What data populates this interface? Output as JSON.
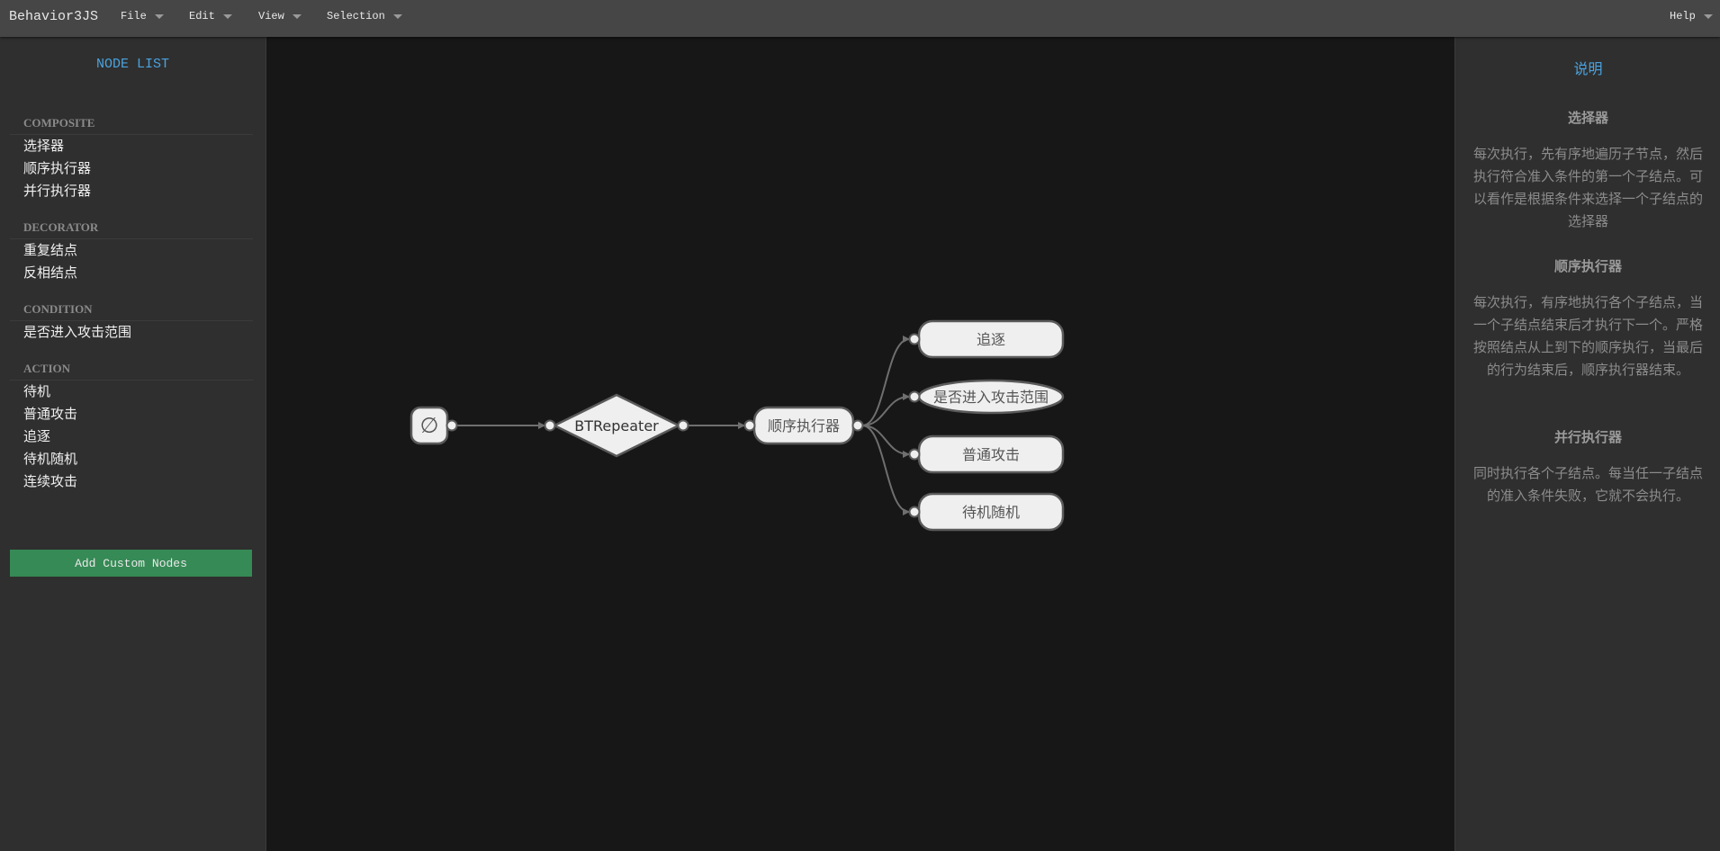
{
  "app": {
    "title": "Behavior3JS"
  },
  "menus": [
    {
      "label": "File"
    },
    {
      "label": "Edit"
    },
    {
      "label": "View"
    },
    {
      "label": "Selection"
    }
  ],
  "help_menu": {
    "label": "Help"
  },
  "sidebar": {
    "title": "NODE LIST",
    "sections": [
      {
        "name": "COMPOSITE",
        "items": [
          "选择器",
          "顺序执行器",
          "并行执行器"
        ]
      },
      {
        "name": "DECORATOR",
        "items": [
          "重复结点",
          "反相结点"
        ]
      },
      {
        "name": "CONDITION",
        "items": [
          "是否进入攻击范围"
        ]
      },
      {
        "name": "ACTION",
        "items": [
          "待机",
          "普通攻击",
          "追逐",
          "待机随机",
          "连续攻击"
        ]
      }
    ],
    "add_button": "Add Custom Nodes",
    "add_button_color": "#368a55"
  },
  "graph": {
    "nodes": [
      {
        "id": "root",
        "type": "root",
        "label": "∅"
      },
      {
        "id": "repeater",
        "type": "decorator",
        "label": "BTRepeater"
      },
      {
        "id": "sequence",
        "type": "composite",
        "label": "顺序执行器"
      },
      {
        "id": "chase",
        "type": "action",
        "label": "追逐"
      },
      {
        "id": "inrange",
        "type": "condition",
        "label": "是否进入攻击范围"
      },
      {
        "id": "attack",
        "type": "action",
        "label": "普通攻击"
      },
      {
        "id": "idle_random",
        "type": "action",
        "label": "待机随机"
      }
    ],
    "edges": [
      [
        "root",
        "repeater"
      ],
      [
        "repeater",
        "sequence"
      ],
      [
        "sequence",
        "chase"
      ],
      [
        "sequence",
        "inrange"
      ],
      [
        "sequence",
        "attack"
      ],
      [
        "sequence",
        "idle_random"
      ]
    ],
    "colors": {
      "node_fill": "#efefef",
      "node_stroke": "#5a5a5a",
      "edge": "#6f6f6f",
      "text": "#555555"
    }
  },
  "panel": {
    "title": "说明",
    "docs": [
      {
        "head": "选择器",
        "body": "每次执行，先有序地遍历子节点，然后执行符合准入条件的第一个子结点。可以看作是根据条件来选择一个子结点的选择器"
      },
      {
        "head": "顺序执行器",
        "body": "每次执行，有序地执行各个子结点，当一个子结点结束后才执行下一个。严格按照结点从上到下的顺序执行，当最后的行为结束后，顺序执行器结束。"
      },
      {
        "head": "并行执行器",
        "body": "同时执行各个子结点。每当任一子结点的准入条件失败，它就不会执行。"
      }
    ]
  }
}
